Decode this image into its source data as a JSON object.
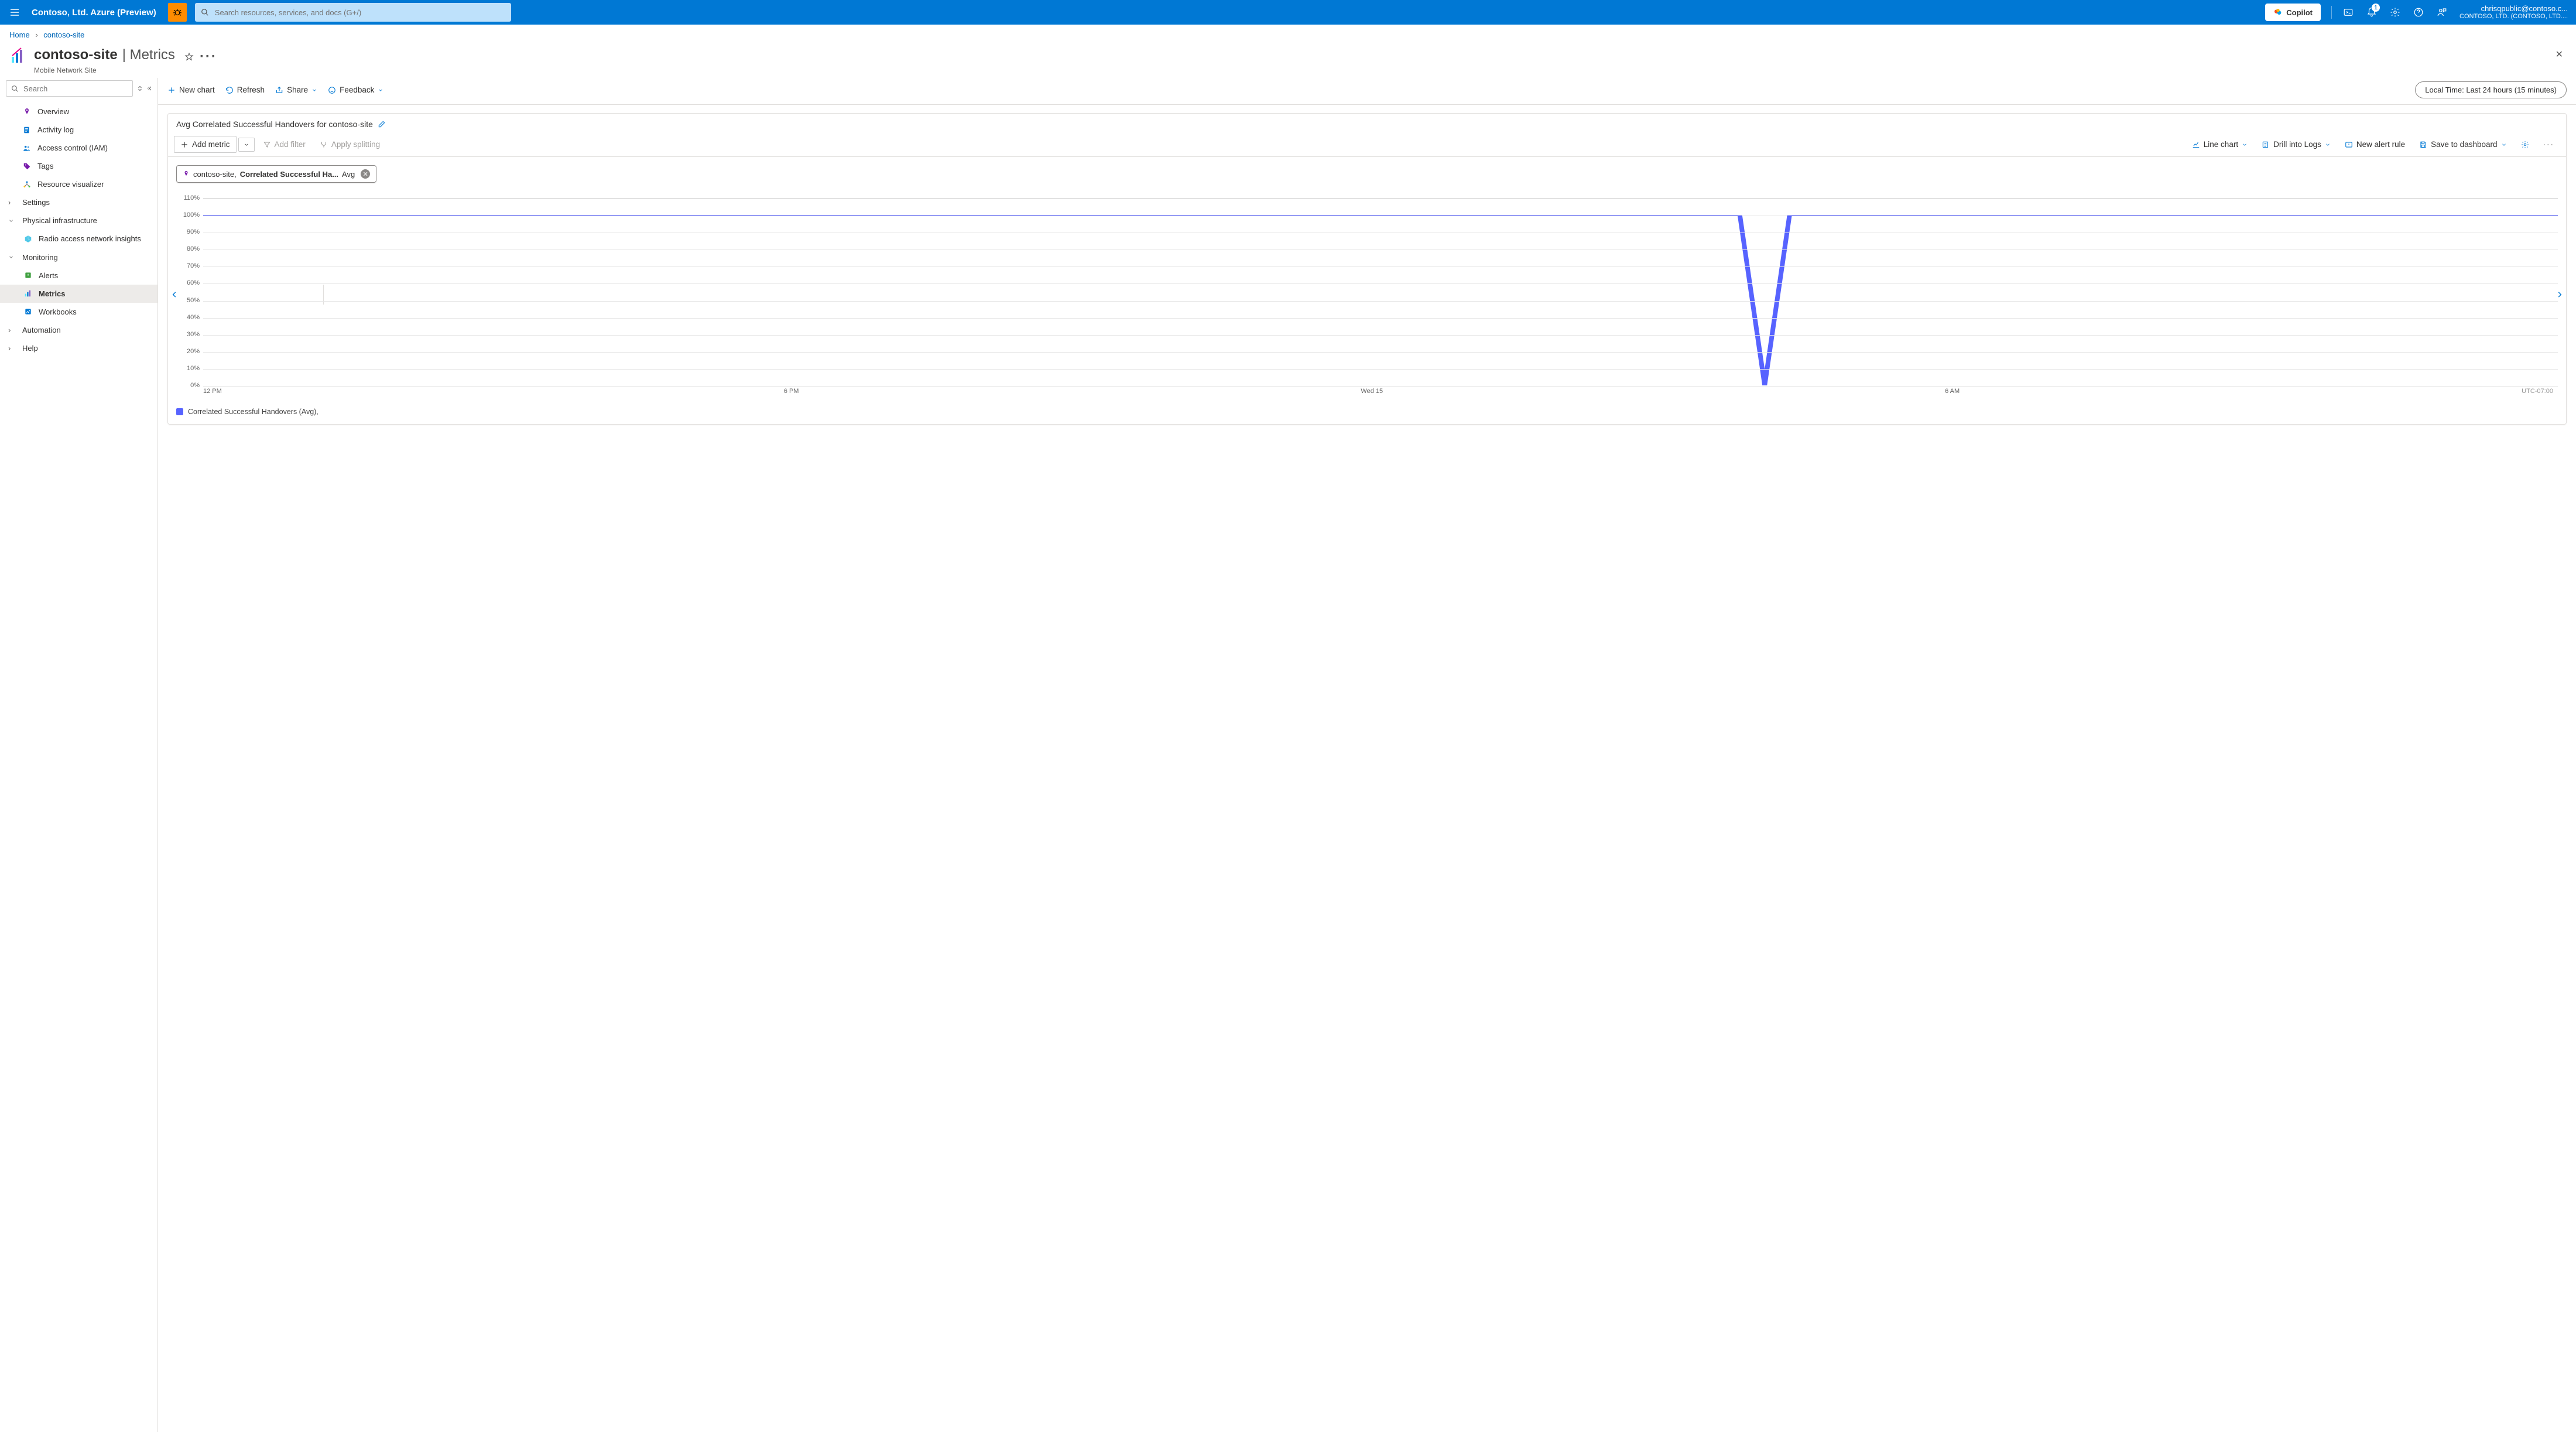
{
  "topbar": {
    "brand": "Contoso, Ltd. Azure (Preview)",
    "search_placeholder": "Search resources, services, and docs (G+/)",
    "copilot": "Copilot",
    "notification_count": "1",
    "account_email": "chrisqpublic@contoso.c...",
    "account_tenant": "CONTOSO, LTD. (CONTOSO, LTD...."
  },
  "breadcrumb": {
    "home": "Home",
    "page": "contoso-site"
  },
  "header": {
    "resource": "contoso-site",
    "section": "Metrics",
    "subtitle": "Mobile Network Site"
  },
  "left_search_placeholder": "Search",
  "nav": {
    "overview": "Overview",
    "activity": "Activity log",
    "iam": "Access control (IAM)",
    "tags": "Tags",
    "resviz": "Resource visualizer",
    "settings": "Settings",
    "physical": "Physical infrastructure",
    "ran": "Radio access network insights",
    "monitoring": "Monitoring",
    "alerts": "Alerts",
    "metrics": "Metrics",
    "workbooks": "Workbooks",
    "automation": "Automation",
    "help": "Help"
  },
  "toolbar": {
    "new_chart": "New chart",
    "refresh": "Refresh",
    "share": "Share",
    "feedback": "Feedback",
    "time_label": "Local Time: Last 24 hours (15 minutes)"
  },
  "chart": {
    "title": "Avg Correlated Successful Handovers for contoso-site",
    "add_metric": "Add metric",
    "add_filter": "Add filter",
    "apply_split": "Apply splitting",
    "line_chart": "Line chart",
    "drill_logs": "Drill into Logs",
    "new_alert": "New alert rule",
    "save_dash": "Save to dashboard",
    "metric_pill_scope": "contoso-site,",
    "metric_pill_metric": "Correlated Successful Ha...",
    "metric_pill_agg": "Avg",
    "legend": "Correlated Successful Handovers (Avg),",
    "x_ticks": [
      "12 PM",
      "6 PM",
      "Wed 15",
      "6 AM"
    ],
    "timezone": "UTC-07:00",
    "y_ticks": [
      "110%",
      "100%",
      "90%",
      "80%",
      "70%",
      "60%",
      "50%",
      "40%",
      "30%",
      "20%",
      "10%",
      "0%"
    ]
  },
  "chart_data": {
    "type": "line",
    "title": "Avg Correlated Successful Handovers for contoso-site",
    "xlabel": "",
    "ylabel": "",
    "ylim": [
      0,
      110
    ],
    "y_ticks_pct": [
      0,
      10,
      20,
      30,
      40,
      50,
      60,
      70,
      80,
      90,
      100,
      110
    ],
    "x_labels": [
      "12 PM",
      "6 PM",
      "Wed 15",
      "6 AM"
    ],
    "x": [
      0,
      1,
      2,
      3,
      4,
      5,
      6,
      7,
      8,
      9,
      10,
      11,
      12,
      13,
      14,
      15,
      16,
      17,
      18,
      19,
      20,
      21,
      22,
      23,
      24,
      25,
      26,
      27,
      28,
      29,
      30,
      31,
      32,
      33,
      34,
      35,
      36,
      37,
      38,
      39,
      40,
      41,
      42,
      43,
      44,
      45,
      46,
      47,
      48,
      49,
      50,
      51,
      52,
      53,
      54,
      55,
      56,
      57,
      58,
      59,
      60,
      61,
      62,
      63,
      64,
      65,
      66,
      67,
      68,
      69,
      70,
      71,
      72,
      73,
      74,
      75,
      76,
      77,
      78,
      79,
      80,
      81,
      82,
      83,
      84,
      85,
      86,
      87,
      88,
      89,
      90,
      91,
      92,
      93,
      94,
      95
    ],
    "series": [
      {
        "name": "Correlated Successful Handovers (Avg)",
        "values": [
          100,
          100,
          100,
          100,
          100,
          100,
          100,
          100,
          100,
          100,
          100,
          100,
          100,
          100,
          100,
          100,
          100,
          100,
          100,
          100,
          100,
          100,
          100,
          100,
          100,
          100,
          100,
          100,
          100,
          100,
          100,
          100,
          100,
          100,
          100,
          100,
          100,
          100,
          100,
          100,
          100,
          100,
          100,
          100,
          100,
          100,
          100,
          100,
          100,
          100,
          100,
          100,
          100,
          100,
          100,
          100,
          100,
          100,
          100,
          100,
          100,
          100,
          100,
          0,
          100,
          100,
          100,
          100,
          100,
          100,
          100,
          100,
          100,
          100,
          100,
          100,
          100,
          100,
          100,
          100,
          100,
          100,
          100,
          100,
          100,
          100,
          100,
          100,
          100,
          100,
          100,
          100,
          100,
          100,
          100,
          100
        ]
      }
    ]
  }
}
